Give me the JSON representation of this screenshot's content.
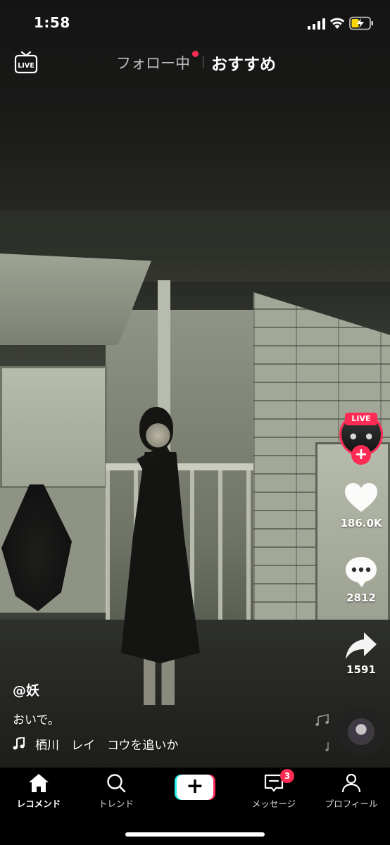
{
  "status_bar": {
    "time": "1:58"
  },
  "top_nav": {
    "live_label": "LIVE",
    "tabs": [
      {
        "label": "フォロー中",
        "has_dot": true
      },
      {
        "label": "おすすめ",
        "active": true
      }
    ]
  },
  "side_rail": {
    "live_badge": "LIVE",
    "follow_symbol": "+",
    "like_count": "186.0K",
    "comment_count": "2812",
    "share_count": "1591"
  },
  "caption": {
    "username": "@妖",
    "description": "おいで。",
    "music": "栖川　レイ　コウを追いか"
  },
  "bottom_nav": {
    "items": [
      {
        "label": "レコメンド",
        "icon": "home-icon",
        "active": true
      },
      {
        "label": "トレンド",
        "icon": "search-icon"
      },
      {
        "label": "+",
        "icon": "create-icon"
      },
      {
        "label": "メッセージ",
        "icon": "inbox-icon",
        "badge": "3"
      },
      {
        "label": "プロフィール",
        "icon": "profile-icon"
      }
    ]
  },
  "colors": {
    "accent": "#fe2c55",
    "cyan": "#25f4ee",
    "background": "#000000"
  }
}
